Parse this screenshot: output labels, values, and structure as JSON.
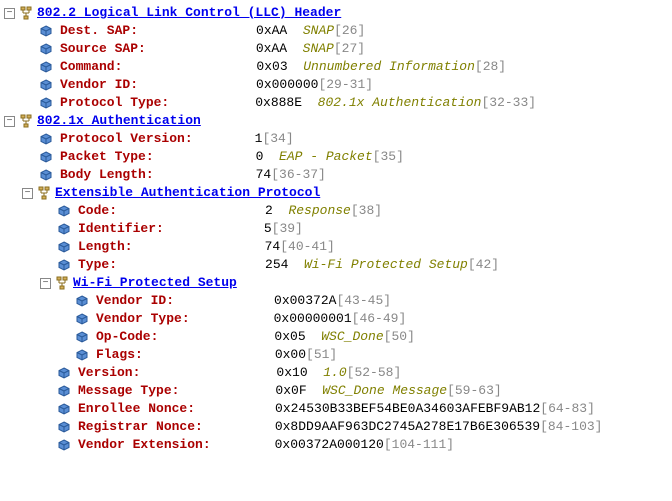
{
  "sections": {
    "llc": {
      "title": "802.2 Logical Link Control (LLC) Header",
      "fields": {
        "destSap": {
          "name": "Dest. SAP:",
          "value": "0xAA",
          "meaning": "SNAP",
          "bytes": "[26]"
        },
        "sourceSap": {
          "name": "Source SAP:",
          "value": "0xAA",
          "meaning": "SNAP",
          "bytes": "[27]"
        },
        "command": {
          "name": "Command:",
          "value": "0x03",
          "meaning": "Unnumbered Information",
          "bytes": "[28]"
        },
        "vendorId": {
          "name": "Vendor ID:",
          "value": "0x000000",
          "bytes": "[29-31]"
        },
        "protocolType": {
          "name": "Protocol Type:",
          "value": "0x888E",
          "meaning": "802.1x Authentication",
          "bytes": "[32-33]"
        }
      }
    },
    "dot1x": {
      "title": "802.1x Authentication",
      "fields": {
        "protocolVersion": {
          "name": "Protocol Version:",
          "value": "1",
          "bytes": "[34]"
        },
        "packetType": {
          "name": "Packet Type:",
          "value": "0",
          "meaning": "EAP - Packet",
          "bytes": "[35]"
        },
        "bodyLength": {
          "name": "Body Length:",
          "value": "74",
          "bytes": "[36-37]"
        }
      }
    },
    "eap": {
      "title": "Extensible Authentication Protocol",
      "fields": {
        "code": {
          "name": "Code:",
          "value": "2",
          "meaning": "Response",
          "bytes": "[38]"
        },
        "identifier": {
          "name": "Identifier:",
          "value": "5",
          "bytes": "[39]"
        },
        "length": {
          "name": "Length:",
          "value": "74",
          "bytes": "[40-41]"
        },
        "type": {
          "name": "Type:",
          "value": "254",
          "meaning": "Wi-Fi Protected Setup",
          "bytes": "[42]"
        }
      }
    },
    "wps": {
      "title": "Wi-Fi Protected Setup",
      "fields": {
        "vendorId": {
          "name": "Vendor ID:",
          "value": "0x00372A",
          "bytes": "[43-45]"
        },
        "vendorType": {
          "name": "Vendor Type:",
          "value": "0x00000001",
          "bytes": "[46-49]"
        },
        "opCode": {
          "name": "Op-Code:",
          "value": "0x05",
          "meaning": "WSC_Done",
          "bytes": "[50]"
        },
        "flags": {
          "name": "Flags:",
          "value": "0x00",
          "bytes": "[51]"
        },
        "version": {
          "name": "Version:",
          "value": "0x10",
          "meaning": "1.0",
          "bytes": "[52-58]"
        },
        "messageType": {
          "name": "Message Type:",
          "value": "0x0F",
          "meaning": "WSC_Done Message",
          "bytes": "[59-63]"
        },
        "enrolleeNonce": {
          "name": "Enrollee Nonce:",
          "value": "0x24530B33BEF54BE0A34603AFEBF9AB12",
          "bytes": "[64-83]"
        },
        "registrarNonce": {
          "name": "Registrar Nonce:",
          "value": "0x8DD9AAF963DC2745A278E17B6E306539",
          "bytes": "[84-103]"
        },
        "vendorExtension": {
          "name": "Vendor Extension:",
          "value": "0x00372A000120",
          "bytes": "[104-111]"
        }
      }
    }
  }
}
